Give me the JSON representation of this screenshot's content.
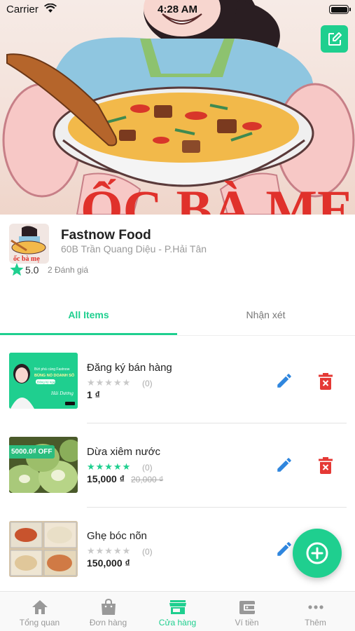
{
  "status_bar": {
    "carrier": "Carrier",
    "time": "4:28 AM"
  },
  "hero": {
    "banner_text": "ỐC BÀ MẸ"
  },
  "store": {
    "logo_text": "ốc bà mẹ",
    "name": "Fastnow Food",
    "address": "60B Trần Quang Diệu - P.Hải Tân",
    "rating": "5.0",
    "reviews": "2 Đánh giá"
  },
  "tabs": [
    {
      "label": "All Items",
      "active": true
    },
    {
      "label": "Nhận xét",
      "active": false
    }
  ],
  "items": [
    {
      "name": "Đăng ký bán hàng",
      "rating": 0,
      "stars_filled": 0,
      "count": "(0)",
      "price": "1 ₫",
      "old_price": ""
    },
    {
      "name": "Dừa xiêm nước",
      "rating": 5,
      "stars_filled": 5,
      "count": "(0)",
      "price": "15,000 ₫",
      "old_price": "20,000 ₫",
      "badge": "5000.0₫ OFF"
    },
    {
      "name": "Ghẹ bóc nõn",
      "rating": 0,
      "stars_filled": 0,
      "count": "(0)",
      "price": "150,000 ₫",
      "old_price": ""
    }
  ],
  "thumb1_text": {
    "line1": "Bứt phá cùng Fastnow",
    "line2": "BÙNG NỔ DOANH SỐ",
    "cta": "Đăng ký ngay",
    "sign": "Hải Dương"
  },
  "bottom_nav": [
    {
      "label": "Tổng quan",
      "icon": "home-icon",
      "active": false
    },
    {
      "label": "Đơn hàng",
      "icon": "shopping-bag-icon",
      "active": false
    },
    {
      "label": "Cửa hàng",
      "icon": "store-icon",
      "active": true
    },
    {
      "label": "Ví tiền",
      "icon": "wallet-icon",
      "active": false
    },
    {
      "label": "Thêm",
      "icon": "more-icon",
      "active": false
    }
  ],
  "colors": {
    "accent": "#1fcf8f",
    "edit": "#2f86de",
    "delete": "#e53935",
    "muted": "#9a9a9a"
  }
}
